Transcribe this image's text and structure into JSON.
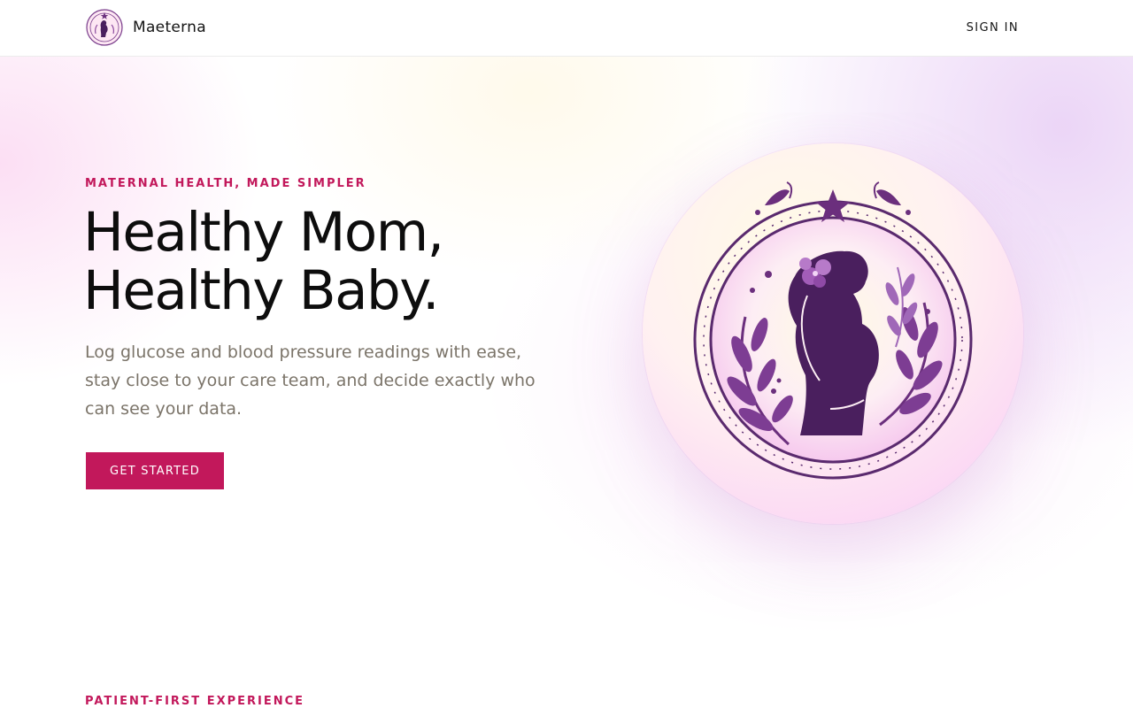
{
  "header": {
    "brand_name": "Maeterna",
    "sign_in_label": "SIGN IN"
  },
  "hero": {
    "eyebrow": "MATERNAL HEALTH, MADE SIMPLER",
    "headline_line1": "Healthy Mom,",
    "headline_line2": "Healthy Baby.",
    "subtext": "Log glucose and blood pressure readings with ease, stay close to your care team, and decide exactly who can see your data.",
    "cta_label": "GET STARTED",
    "illustration_icon": "pregnant-woman-emblem-icon"
  },
  "next_section": {
    "eyebrow": "PATIENT-FIRST EXPERIENCE"
  },
  "colors": {
    "accent": "#c2185b",
    "emblem_purple": "#5a2a6e",
    "text_dark": "#0d0d0d",
    "text_muted": "#7b7469"
  }
}
